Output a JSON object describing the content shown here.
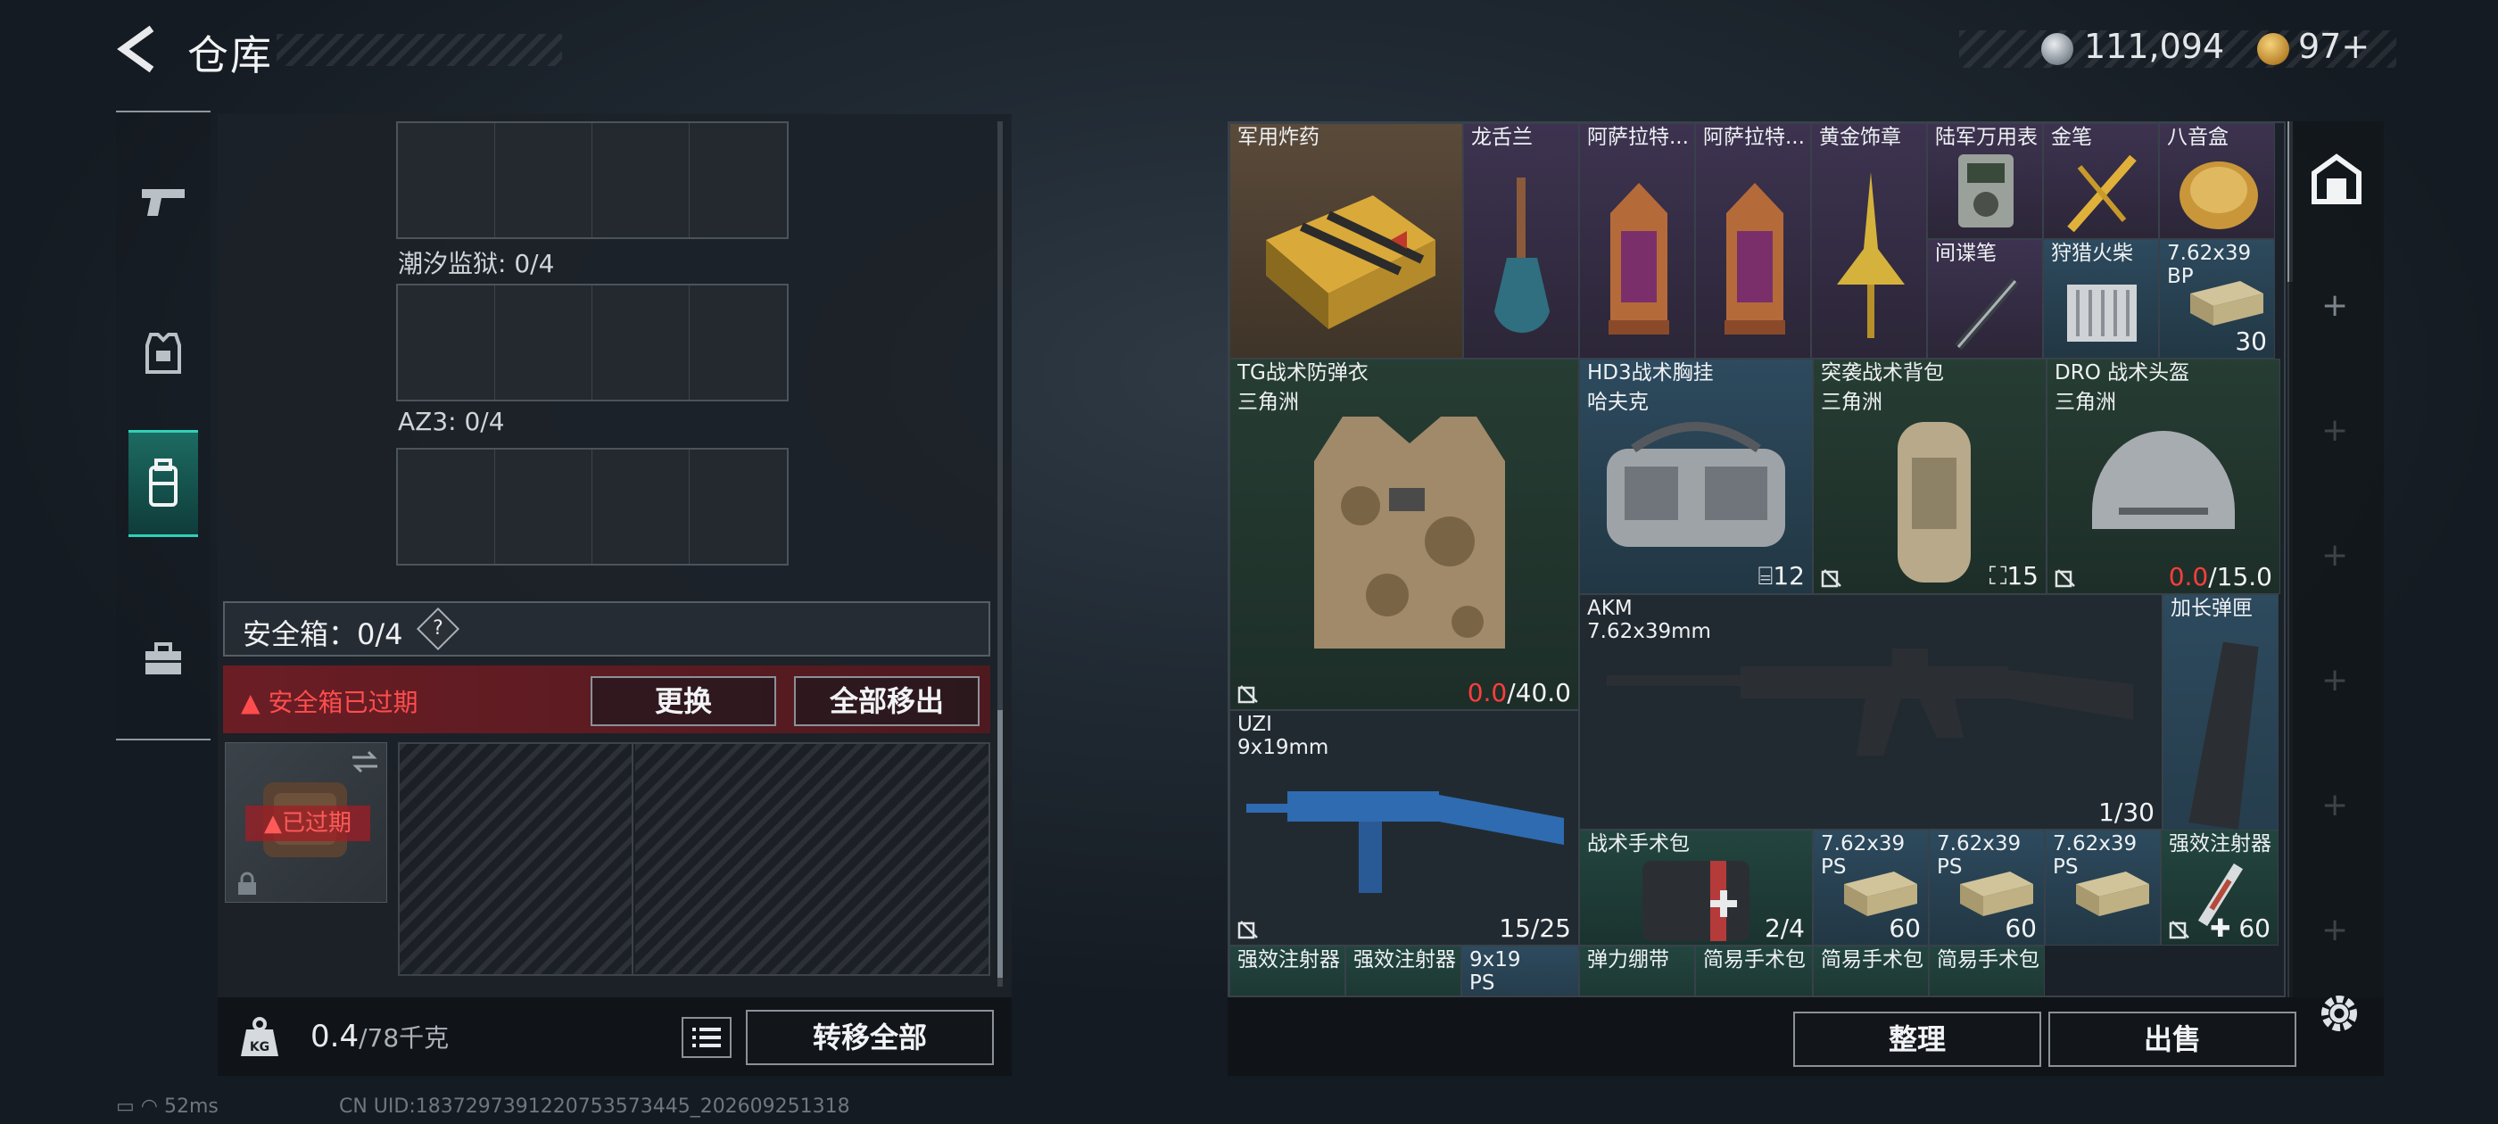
{
  "header": {
    "title": "仓库",
    "currency_silver": "111,094",
    "currency_gold": "97+"
  },
  "nav": [
    {
      "name": "weapons"
    },
    {
      "name": "armor"
    },
    {
      "name": "backpack",
      "active": true
    },
    {
      "name": "toolbox"
    }
  ],
  "containers": {
    "labels": [
      "潮汐监狱: 0/4",
      "AZ3: 0/4"
    ],
    "safe_box_label": "安全箱：0/4",
    "help": "?",
    "expired_warning": "安全箱已过期",
    "replace_button": "更换",
    "remove_all_button": "全部移出",
    "expired_tag": "已过期"
  },
  "footer": {
    "weight_value": "0.4",
    "weight_capacity": "/78千克",
    "transfer_all_button": "转移全部",
    "ping": "52ms",
    "uid": "CN UID:1837297391220753573445_202609251318"
  },
  "inventory": [
    {
      "id": "explosive",
      "name": "军用炸药",
      "rarity": "gold"
    },
    {
      "id": "dragon",
      "name": "龙舌兰",
      "rarity": "purple"
    },
    {
      "id": "lantern1",
      "name": "阿萨拉特...",
      "rarity": "purple"
    },
    {
      "id": "lantern2",
      "name": "阿萨拉特...",
      "rarity": "purple"
    },
    {
      "id": "badge",
      "name": "黄金饰章",
      "rarity": "purple"
    },
    {
      "id": "watch",
      "name": "陆军万用表",
      "rarity": "purple"
    },
    {
      "id": "goldpen",
      "name": "金笔",
      "rarity": "purple"
    },
    {
      "id": "musicbox",
      "name": "八音盒",
      "rarity": "purple"
    },
    {
      "id": "spypen",
      "name": "间谍笔",
      "rarity": "purple"
    },
    {
      "id": "matches",
      "name": "狩猎火柴",
      "rarity": "blue"
    },
    {
      "id": "ammo1",
      "name": "7.62x39",
      "sub": "BP",
      "count": "30",
      "rarity": "blue"
    },
    {
      "id": "vest",
      "name": "TG战术防弹衣",
      "sub": "三角洲",
      "count_red": "0.0",
      "count": "/40.0",
      "rarity": "green"
    },
    {
      "id": "chestrig",
      "name": "HD3战术胸挂",
      "sub": "哈夫克",
      "count": "12",
      "rarity": "blue"
    },
    {
      "id": "backpack",
      "name": "突袭战术背包",
      "sub": "三角洲",
      "count": "15",
      "rarity": "green"
    },
    {
      "id": "helmet",
      "name": "DRO 战术头盔",
      "sub": "三角洲",
      "count_red": "0.0",
      "count": "/15.0",
      "rarity": "green"
    },
    {
      "id": "akm",
      "name": "AKM",
      "sub": "7.62x39mm",
      "count": "1/30",
      "rarity": "grey"
    },
    {
      "id": "mag",
      "name": "加长弹匣",
      "rarity": "blue"
    },
    {
      "id": "uzi",
      "name": "UZI",
      "sub": "9x19mm",
      "count": "15/25",
      "rarity": "grey"
    },
    {
      "id": "medkit",
      "name": "战术手术包",
      "count": "2/4",
      "rarity": "teal"
    },
    {
      "id": "ammo2",
      "name": "7.62x39",
      "sub": "PS",
      "count": "60",
      "rarity": "blue"
    },
    {
      "id": "ammo3",
      "name": "7.62x39",
      "sub": "PS",
      "count": "60",
      "rarity": "blue"
    },
    {
      "id": "ammo4",
      "name": "7.62x39",
      "sub": "PS",
      "count": "",
      "rarity": "blue"
    },
    {
      "id": "injector1",
      "name": "强效注射器",
      "count": "60",
      "rarity": "teal"
    },
    {
      "id": "injector2",
      "name": "强效注射器",
      "rarity": "teal"
    },
    {
      "id": "injector3",
      "name": "强效注射器",
      "rarity": "teal"
    },
    {
      "id": "ammo5",
      "name": "9x19",
      "sub": "PS",
      "rarity": "blue"
    },
    {
      "id": "bandage",
      "name": "弹力绷带",
      "rarity": "teal"
    },
    {
      "id": "kit1",
      "name": "简易手术包",
      "rarity": "teal"
    },
    {
      "id": "kit2",
      "name": "简易手术包",
      "rarity": "teal"
    },
    {
      "id": "kit3",
      "name": "简易手术包",
      "rarity": "teal"
    }
  ],
  "actions": {
    "sort_button": "整理",
    "sell_button": "出售"
  },
  "colors": {
    "accent": "#2fd1b6",
    "danger": "#ff3d3d",
    "gold_rarity": "#5a4a3a",
    "purple_rarity": "#3d3350",
    "blue_rarity": "#2d4a5e",
    "green_rarity": "#263d33"
  }
}
